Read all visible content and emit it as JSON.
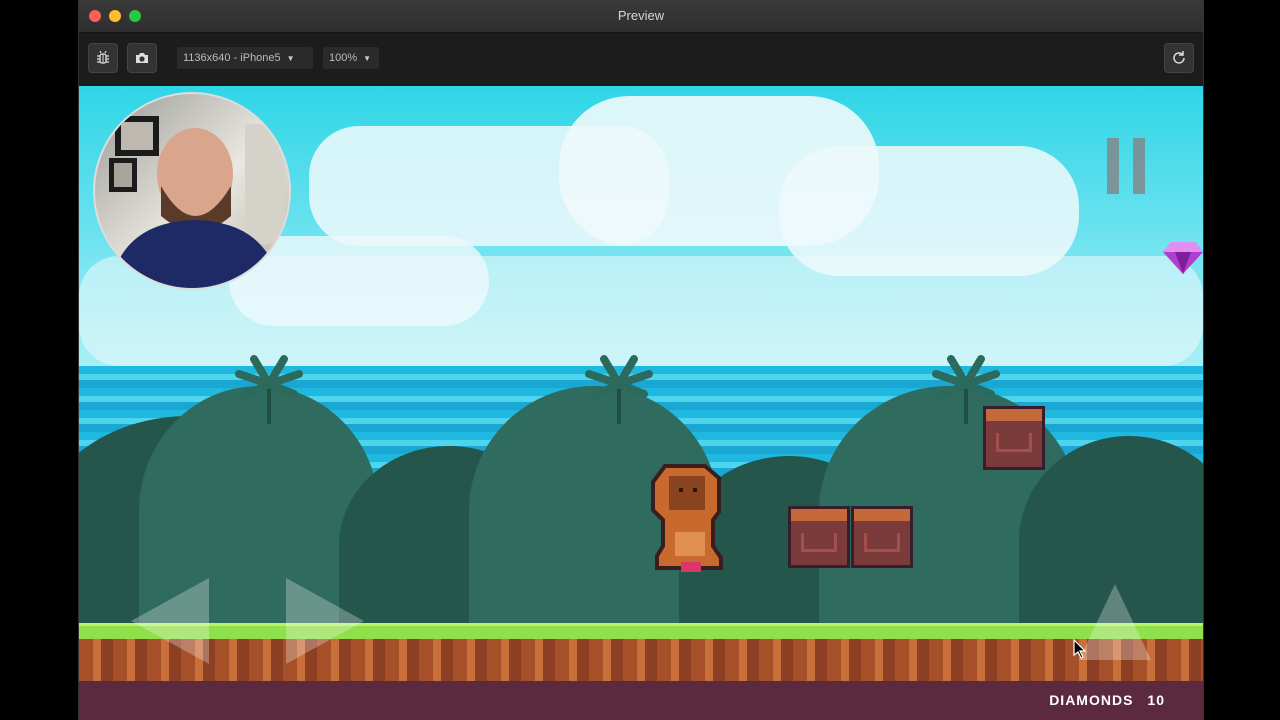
{
  "window": {
    "title": "Preview"
  },
  "traffic_lights": {
    "close": "#ff5f57",
    "minimize": "#febc2e",
    "maximize": "#28c840"
  },
  "toolbar": {
    "debug_icon": "bug-icon",
    "screenshot_icon": "camera-icon",
    "device_select": {
      "value": "1136x640 - iPhone5"
    },
    "zoom_select": {
      "value": "100%"
    },
    "reload_icon": "reload-icon"
  },
  "game": {
    "hud": {
      "score_label": "DIAMONDS",
      "score_value": "10"
    },
    "pause_icon": "pause-icon",
    "diamond_icon": "diamond-icon",
    "controls": {
      "left": "left-arrow-icon",
      "right": "right-arrow-icon",
      "jump": "up-arrow-icon"
    }
  }
}
